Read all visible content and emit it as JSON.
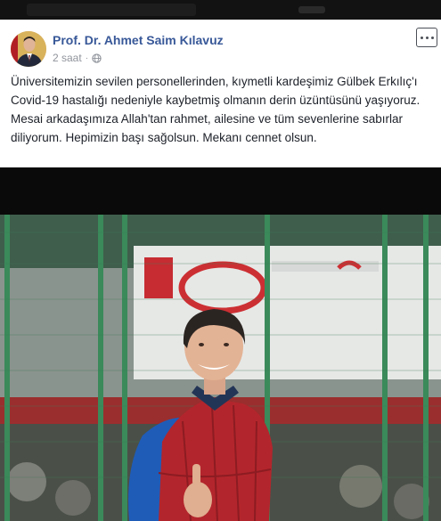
{
  "post": {
    "author": "Prof. Dr. Ahmet Saim Kılavuz",
    "time": "2 saat",
    "separator": "·",
    "privacy_icon": "globe-icon",
    "options_icon": "more-options-icon",
    "text": "Üniversitemizin sevilen personellerinden, kıymetli kardeşimiz Gülbek Erkılıç'ı Covid-19 hastalığı nedeniyle kaybetmiş olmanın derin üzüntüsünü yaşıyoruz. Mesai arkadaşımıza Allah'tan rahmet, ailesine ve tüm sevenlerine sabırlar diliyorum. Hepimizin başı sağolsun. Mekanı cennet olsun."
  },
  "colors": {
    "author_link": "#385898",
    "meta_gray": "#90949c",
    "text": "#1d2129",
    "vest_red": "#b3252c",
    "fence_green": "#2f7a4f"
  }
}
